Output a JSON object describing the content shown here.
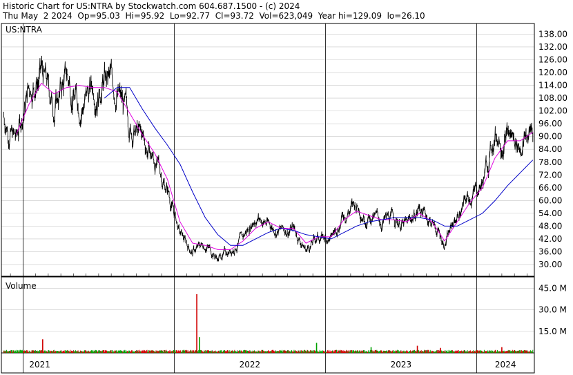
{
  "header": {
    "line1": "Historic Chart for US:NTRA by Stockwatch.com 604.687.1500 - (c) 2024",
    "line2": "Thu May  2 2024  Op=95.03  Hi=95.92  Lo=92.77  Cl=93.72  Vol=623,049  Year hi=129.09  lo=26.10"
  },
  "colors": {
    "price": "#000000",
    "ma_short": "#e000e0",
    "ma_long": "#0000c8",
    "volume_up": "#00a000",
    "volume_down": "#d00000",
    "grid": "#c8c8c8"
  },
  "chart_data": [
    {
      "type": "line",
      "panel_label": "US:NTRA",
      "y_ticks": [
        30,
        36,
        42,
        48,
        54,
        60,
        66,
        72,
        78,
        84,
        90,
        96,
        102,
        108,
        114,
        120,
        126,
        132,
        138
      ],
      "y_tick_labels": [
        "30.00",
        "36.00",
        "42.00",
        "48.00",
        "54.00",
        "60.00",
        "66.00",
        "72.00",
        "78.00",
        "84.00",
        "90.00",
        "96.00",
        "102.00",
        "108.00",
        "114.00",
        "120.00",
        "126.00",
        "132.00",
        "138.00"
      ],
      "ylim": [
        24.5,
        143
      ],
      "x_range": [
        "2020-11",
        "2024-05"
      ],
      "series": [
        {
          "key": "close",
          "x": [
            "2020-11",
            "2020-12",
            "2021-01",
            "2021-02",
            "2021-03",
            "2021-04",
            "2021-05",
            "2021-06",
            "2021-07",
            "2021-08",
            "2021-09",
            "2021-10",
            "2021-11",
            "2021-12",
            "2022-01",
            "2022-02",
            "2022-03",
            "2022-04",
            "2022-05",
            "2022-06",
            "2022-07",
            "2022-08",
            "2022-09",
            "2022-10",
            "2022-11",
            "2022-12",
            "2023-01",
            "2023-02",
            "2023-03",
            "2023-04",
            "2023-05",
            "2023-06",
            "2023-07",
            "2023-08",
            "2023-09",
            "2023-10",
            "2023-11",
            "2023-12",
            "2024-01",
            "2024-02",
            "2024-03",
            "2024-04",
            "2024-05"
          ],
          "values": [
            100,
            88,
            113,
            120,
            104,
            118,
            105,
            112,
            117,
            112,
            95,
            89,
            78,
            66,
            44,
            36,
            40,
            33,
            37,
            42,
            53,
            49,
            46,
            47,
            37,
            43,
            42,
            54,
            58,
            53,
            50,
            52,
            48,
            57,
            50,
            40,
            53,
            62,
            68,
            91,
            92,
            86,
            94
          ]
        },
        {
          "key": "ma_short",
          "x": [
            "2020-11",
            "2020-12",
            "2021-01",
            "2021-02",
            "2021-03",
            "2021-04",
            "2021-05",
            "2021-06",
            "2021-07",
            "2021-08",
            "2021-09",
            "2021-10",
            "2021-11",
            "2021-12",
            "2022-01",
            "2022-02",
            "2022-03",
            "2022-04",
            "2022-05",
            "2022-06",
            "2022-07",
            "2022-08",
            "2022-09",
            "2022-10",
            "2022-11",
            "2022-12",
            "2023-01",
            "2023-02",
            "2023-03",
            "2023-04",
            "2023-05",
            "2023-06",
            "2023-07",
            "2023-08",
            "2023-09",
            "2023-10",
            "2023-11",
            "2023-12",
            "2024-01",
            "2024-02",
            "2024-03",
            "2024-04",
            "2024-05"
          ],
          "values": [
            null,
            91,
            105,
            115,
            110,
            113,
            114,
            113,
            113,
            111,
            101,
            91,
            82,
            70,
            50,
            40,
            39,
            37,
            37,
            41,
            47,
            50,
            47,
            47,
            40,
            43,
            43,
            51,
            55,
            53,
            51,
            51,
            50,
            54,
            50,
            41,
            50,
            59,
            66,
            80,
            88,
            88,
            92
          ]
        },
        {
          "key": "ma_long",
          "x": [
            "2021-07",
            "2021-08",
            "2021-09",
            "2021-10",
            "2021-11",
            "2021-12",
            "2022-01",
            "2022-02",
            "2022-03",
            "2022-04",
            "2022-05",
            "2022-06",
            "2022-07",
            "2022-08",
            "2022-09",
            "2022-10",
            "2022-11",
            "2022-12",
            "2023-01",
            "2023-02",
            "2023-03",
            "2023-04",
            "2023-05",
            "2023-06",
            "2023-07",
            "2023-08",
            "2023-09",
            "2023-10",
            "2023-11",
            "2023-12",
            "2024-01",
            "2024-02",
            "2024-03",
            "2024-04",
            "2024-05"
          ],
          "values": [
            108,
            113,
            113,
            103,
            94,
            86,
            77,
            64,
            52,
            44,
            39,
            39,
            42,
            45,
            47,
            46,
            44,
            43,
            42,
            45,
            48,
            50,
            51,
            52,
            52,
            52,
            51,
            48,
            48,
            51,
            54,
            60,
            67,
            73,
            79
          ]
        }
      ]
    },
    {
      "type": "bar",
      "panel_label": "Volume",
      "y_tick_labels": [
        "15.0 M",
        "30.0 M",
        "45.0 M"
      ],
      "y_ticks": [
        15,
        30,
        45
      ],
      "ylim": [
        0,
        53
      ],
      "x_range": [
        "2020-11",
        "2024-05"
      ],
      "spikes": [
        {
          "x": "2021-02-18",
          "value": 9.5,
          "up": false
        },
        {
          "x": "2022-02-25",
          "value": 41,
          "up": false
        },
        {
          "x": "2022-03-01",
          "value": 11,
          "up": true
        },
        {
          "x": "2022-12-10",
          "value": 7,
          "up": true
        },
        {
          "x": "2023-04-20",
          "value": 4,
          "up": true
        },
        {
          "x": "2023-08-10",
          "value": 5,
          "up": false
        },
        {
          "x": "2023-10-05",
          "value": 3.5,
          "up": false
        },
        {
          "x": "2024-03-01",
          "value": 4,
          "up": false
        }
      ],
      "baseline_volume": 1.4
    }
  ],
  "x_axis": {
    "labels": [
      "2021",
      "2022",
      "2023",
      "2024"
    ]
  }
}
